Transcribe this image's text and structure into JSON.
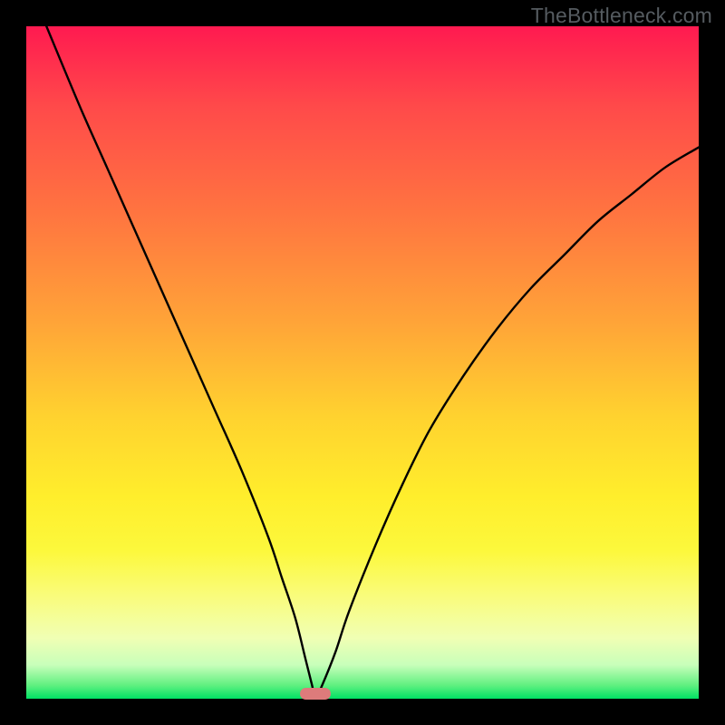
{
  "watermark": "TheBottleneck.com",
  "chart_data": {
    "type": "line",
    "title": "",
    "xlabel": "",
    "ylabel": "",
    "xlim": [
      0,
      100
    ],
    "ylim": [
      0,
      100
    ],
    "grid": false,
    "legend": false,
    "series": [
      {
        "name": "bottleneck-curve",
        "x": [
          3,
          8,
          12,
          16,
          20,
          24,
          28,
          32,
          36,
          38,
          40,
          41.5,
          42.5,
          43,
          44,
          46,
          48,
          52,
          56,
          60,
          65,
          70,
          75,
          80,
          85,
          90,
          95,
          100
        ],
        "values": [
          100,
          88,
          79,
          70,
          61,
          52,
          43,
          34,
          24,
          18,
          12,
          6,
          2,
          0,
          2,
          7,
          13,
          23,
          32,
          40,
          48,
          55,
          61,
          66,
          71,
          75,
          79,
          82
        ]
      }
    ],
    "annotations": [
      {
        "name": "min-marker",
        "x": 43,
        "y": 0,
        "width_pct": 4.5,
        "height_pct": 1.7,
        "color": "#dd7b7b"
      }
    ],
    "background": {
      "type": "vertical-gradient",
      "stops": [
        {
          "pct": 0,
          "color": "#ff1a50"
        },
        {
          "pct": 28,
          "color": "#ff7540"
        },
        {
          "pct": 58,
          "color": "#ffd22f"
        },
        {
          "pct": 85,
          "color": "#f9fc7e"
        },
        {
          "pct": 100,
          "color": "#00e264"
        }
      ]
    }
  }
}
